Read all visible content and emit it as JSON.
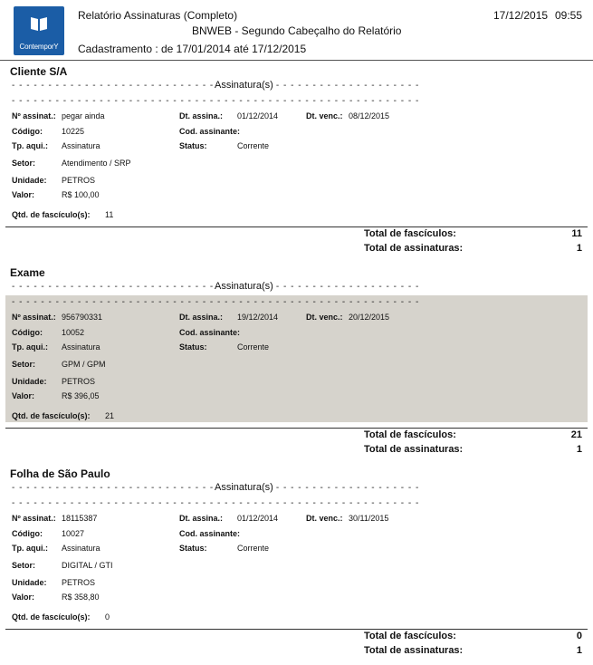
{
  "header": {
    "logo_text": "ContemporY",
    "title": "Relatório Assinaturas (Completo)",
    "subtitle": "BNWEB - Segundo Cabeçalho do Relatório",
    "date": "17/12/2015",
    "time": "09:55",
    "period_label": "Cadastramento :",
    "period_value": "de 17/01/2014 até 17/12/2015"
  },
  "labels": {
    "section": "Assinatura(s)",
    "num_assinat": "Nº assinat.:",
    "dt_assina": "Dt. assina.:",
    "dt_venc": "Dt. venc.:",
    "codigo": "Código:",
    "cod_assinante": "Cod. assinante:",
    "tp_aqui": "Tp. aqui.:",
    "status": "Status:",
    "setor": "Setor:",
    "unidade": "Unidade:",
    "valor": "Valor:",
    "qtd": "Qtd. de fascículo(s):",
    "total_fasciculos": "Total de fascículos:",
    "total_assinaturas": "Total de assinaturas:"
  },
  "clients": [
    {
      "name": "Cliente S/A",
      "num_assinat": "pegar ainda",
      "dt_assina": "01/12/2014",
      "dt_venc": "08/12/2015",
      "codigo": "10225",
      "cod_assinante": "",
      "tp_aqui": "Assinatura",
      "status": "Corrente",
      "setor": "Atendimento / SRP",
      "unidade": "PETROS",
      "valor": "R$ 100,00",
      "qtd": "11",
      "total_fasciculos": "11",
      "total_assinaturas": "1"
    },
    {
      "name": "Exame",
      "num_assinat": "956790331",
      "dt_assina": "19/12/2014",
      "dt_venc": "20/12/2015",
      "codigo": "10052",
      "cod_assinante": "",
      "tp_aqui": "Assinatura",
      "status": "Corrente",
      "setor": "GPM / GPM",
      "unidade": "PETROS",
      "valor": "R$ 396,05",
      "qtd": "21",
      "total_fasciculos": "21",
      "total_assinaturas": "1"
    },
    {
      "name": "Folha de São Paulo",
      "num_assinat": "18115387",
      "dt_assina": "01/12/2014",
      "dt_venc": "30/11/2015",
      "codigo": "10027",
      "cod_assinante": "",
      "tp_aqui": "Assinatura",
      "status": "Corrente",
      "setor": "DIGITAL / GTI",
      "unidade": "PETROS",
      "valor": "R$ 358,80",
      "qtd": "0",
      "total_fasciculos": "0",
      "total_assinaturas": "1"
    }
  ]
}
